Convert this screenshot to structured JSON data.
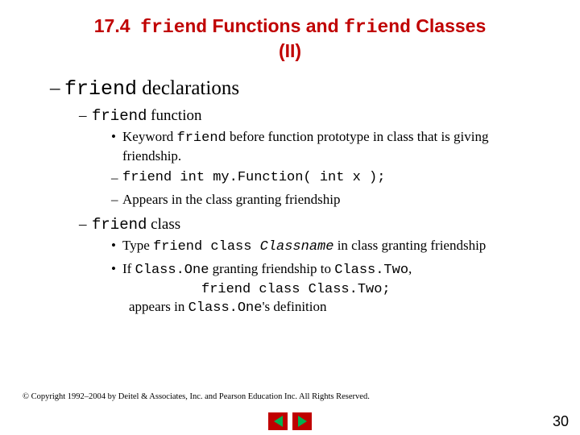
{
  "title": {
    "section_num": "17.4",
    "kw1": "friend",
    "mid1": "Functions and",
    "kw2": "friend",
    "mid2": "Classes",
    "line2": "(II)"
  },
  "l1": {
    "dash": "–",
    "kw": "friend",
    "rest": " declarations"
  },
  "l2a": {
    "dash": "–",
    "kw": "friend",
    "rest": " function"
  },
  "l3a": {
    "bullet": "•",
    "pre": "Keyword ",
    "kw": "friend",
    "post": " before function prototype in class that is giving friendship."
  },
  "l3b": {
    "dash": "–",
    "code": "friend int my.Function( int x );"
  },
  "l3c": {
    "dash": "–",
    "text": "Appears in the class granting friendship"
  },
  "l2b": {
    "dash": "–",
    "kw": "friend",
    "rest": " class"
  },
  "l3d": {
    "bullet": "•",
    "pre": "Type ",
    "code": "friend class ",
    "classname": "Classname",
    "post": " in class granting friendship"
  },
  "l3e": {
    "bullet": "•",
    "pre": "If ",
    "c1": "Class.One",
    "mid": " granting friendship to ",
    "c2": "Class.Two",
    "comma": ","
  },
  "codeline": "friend class Class.Two;",
  "appears": {
    "pre": "appears in ",
    "code": "Class.One",
    "post": "'s definition"
  },
  "copyright": "© Copyright 1992–2004 by Deitel & Associates, Inc. and Pearson Education Inc. All Rights Reserved.",
  "pagenum": "30"
}
